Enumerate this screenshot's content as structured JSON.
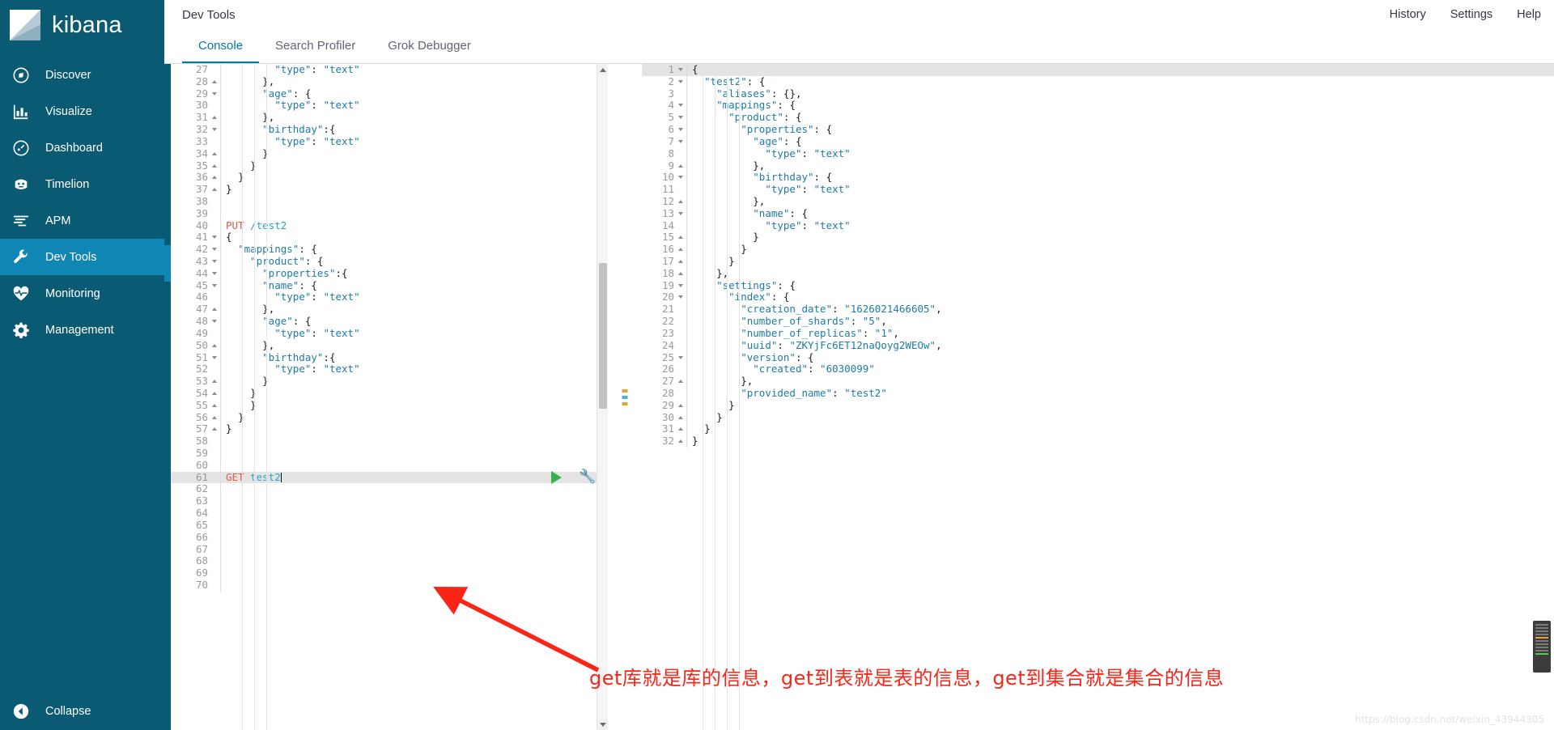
{
  "app": {
    "brand": "kibana",
    "brand_logo_icon": "kibana-logo-icon"
  },
  "sidebar": {
    "items": [
      {
        "label": "Discover",
        "icon": "compass-icon",
        "active": false
      },
      {
        "label": "Visualize",
        "icon": "bar-chart-icon",
        "active": false
      },
      {
        "label": "Dashboard",
        "icon": "dashboard-gauge-icon",
        "active": false
      },
      {
        "label": "Timelion",
        "icon": "timelion-icon",
        "active": false
      },
      {
        "label": "APM",
        "icon": "apm-lines-icon",
        "active": false
      },
      {
        "label": "Dev Tools",
        "icon": "wrench-icon",
        "active": true
      },
      {
        "label": "Monitoring",
        "icon": "heartbeat-icon",
        "active": false
      },
      {
        "label": "Management",
        "icon": "gear-icon",
        "active": false
      }
    ],
    "collapse": {
      "label": "Collapse",
      "icon": "chevron-left-circle-icon"
    }
  },
  "header": {
    "title": "Dev Tools",
    "links": [
      {
        "label": "History",
        "name": "history-link"
      },
      {
        "label": "Settings",
        "name": "settings-link"
      },
      {
        "label": "Help",
        "name": "help-link"
      }
    ]
  },
  "tabs": [
    {
      "label": "Console",
      "active": true
    },
    {
      "label": "Search Profiler",
      "active": false
    },
    {
      "label": "Grok Debugger",
      "active": false
    }
  ],
  "editor": {
    "first_line_number": 27,
    "cursor_line": 61,
    "run_button_icon": "play-triangle-icon",
    "wrench_button_icon": "wrench-icon",
    "lines": [
      {
        "n": 27,
        "fold": "",
        "text": "        \"type\": \"text\""
      },
      {
        "n": 28,
        "fold": "up",
        "text": "      },"
      },
      {
        "n": 29,
        "fold": "down",
        "text": "      \"age\": {"
      },
      {
        "n": 30,
        "fold": "",
        "text": "        \"type\": \"text\""
      },
      {
        "n": 31,
        "fold": "up",
        "text": "      },"
      },
      {
        "n": 32,
        "fold": "down",
        "text": "      \"birthday\":{"
      },
      {
        "n": 33,
        "fold": "",
        "text": "        \"type\": \"text\""
      },
      {
        "n": 34,
        "fold": "up",
        "text": "      }"
      },
      {
        "n": 35,
        "fold": "up",
        "text": "    }"
      },
      {
        "n": 36,
        "fold": "up",
        "text": "  }"
      },
      {
        "n": 37,
        "fold": "up",
        "text": "}"
      },
      {
        "n": 38,
        "fold": "",
        "text": ""
      },
      {
        "n": 39,
        "fold": "",
        "text": ""
      },
      {
        "n": 40,
        "fold": "",
        "text": "PUT /test2",
        "kind": "request"
      },
      {
        "n": 41,
        "fold": "down",
        "text": "{"
      },
      {
        "n": 42,
        "fold": "down",
        "text": "  \"mappings\": {"
      },
      {
        "n": 43,
        "fold": "down",
        "text": "    \"product\": {"
      },
      {
        "n": 44,
        "fold": "down",
        "text": "      \"properties\":{"
      },
      {
        "n": 45,
        "fold": "down",
        "text": "      \"name\": {"
      },
      {
        "n": 46,
        "fold": "",
        "text": "        \"type\": \"text\""
      },
      {
        "n": 47,
        "fold": "up",
        "text": "      },"
      },
      {
        "n": 48,
        "fold": "down",
        "text": "      \"age\": {"
      },
      {
        "n": 49,
        "fold": "",
        "text": "        \"type\": \"text\""
      },
      {
        "n": 50,
        "fold": "up",
        "text": "      },"
      },
      {
        "n": 51,
        "fold": "down",
        "text": "      \"birthday\":{"
      },
      {
        "n": 52,
        "fold": "",
        "text": "        \"type\": \"text\""
      },
      {
        "n": 53,
        "fold": "up",
        "text": "      }"
      },
      {
        "n": 54,
        "fold": "up",
        "text": "    }"
      },
      {
        "n": 55,
        "fold": "up",
        "text": "    }"
      },
      {
        "n": 56,
        "fold": "up",
        "text": "  }"
      },
      {
        "n": 57,
        "fold": "up",
        "text": "}"
      },
      {
        "n": 58,
        "fold": "",
        "text": ""
      },
      {
        "n": 59,
        "fold": "",
        "text": ""
      },
      {
        "n": 60,
        "fold": "",
        "text": ""
      },
      {
        "n": 61,
        "fold": "",
        "text": "GET test2",
        "kind": "request",
        "highlight": true
      },
      {
        "n": 62,
        "fold": "",
        "text": ""
      },
      {
        "n": 63,
        "fold": "",
        "text": ""
      },
      {
        "n": 64,
        "fold": "",
        "text": ""
      },
      {
        "n": 65,
        "fold": "",
        "text": ""
      },
      {
        "n": 66,
        "fold": "",
        "text": ""
      },
      {
        "n": 67,
        "fold": "",
        "text": ""
      },
      {
        "n": 68,
        "fold": "",
        "text": ""
      },
      {
        "n": 69,
        "fold": "",
        "text": ""
      },
      {
        "n": 70,
        "fold": "",
        "text": ""
      }
    ]
  },
  "output": {
    "lines": [
      {
        "n": 1,
        "fold": "down",
        "text": "{",
        "highlight": true
      },
      {
        "n": 2,
        "fold": "down",
        "text": "  \"test2\": {"
      },
      {
        "n": 3,
        "fold": "",
        "text": "    \"aliases\": {},"
      },
      {
        "n": 4,
        "fold": "down",
        "text": "    \"mappings\": {"
      },
      {
        "n": 5,
        "fold": "down",
        "text": "      \"product\": {"
      },
      {
        "n": 6,
        "fold": "down",
        "text": "        \"properties\": {"
      },
      {
        "n": 7,
        "fold": "down",
        "text": "          \"age\": {"
      },
      {
        "n": 8,
        "fold": "",
        "text": "            \"type\": \"text\""
      },
      {
        "n": 9,
        "fold": "up",
        "text": "          },"
      },
      {
        "n": 10,
        "fold": "down",
        "text": "          \"birthday\": {"
      },
      {
        "n": 11,
        "fold": "",
        "text": "            \"type\": \"text\""
      },
      {
        "n": 12,
        "fold": "up",
        "text": "          },"
      },
      {
        "n": 13,
        "fold": "down",
        "text": "          \"name\": {"
      },
      {
        "n": 14,
        "fold": "",
        "text": "            \"type\": \"text\""
      },
      {
        "n": 15,
        "fold": "up",
        "text": "          }"
      },
      {
        "n": 16,
        "fold": "up",
        "text": "        }"
      },
      {
        "n": 17,
        "fold": "up",
        "text": "      }"
      },
      {
        "n": 18,
        "fold": "up",
        "text": "    },"
      },
      {
        "n": 19,
        "fold": "down",
        "text": "    \"settings\": {"
      },
      {
        "n": 20,
        "fold": "down",
        "text": "      \"index\": {"
      },
      {
        "n": 21,
        "fold": "",
        "text": "        \"creation_date\": \"1626021466605\","
      },
      {
        "n": 22,
        "fold": "",
        "text": "        \"number_of_shards\": \"5\","
      },
      {
        "n": 23,
        "fold": "",
        "text": "        \"number_of_replicas\": \"1\","
      },
      {
        "n": 24,
        "fold": "",
        "text": "        \"uuid\": \"ZKYjFc6ET12naQoyg2WEOw\","
      },
      {
        "n": 25,
        "fold": "down",
        "text": "        \"version\": {"
      },
      {
        "n": 26,
        "fold": "",
        "text": "          \"created\": \"6030099\""
      },
      {
        "n": 27,
        "fold": "up",
        "text": "        },"
      },
      {
        "n": 28,
        "fold": "",
        "text": "        \"provided_name\": \"test2\""
      },
      {
        "n": 29,
        "fold": "up",
        "text": "      }"
      },
      {
        "n": 30,
        "fold": "up",
        "text": "    }"
      },
      {
        "n": 31,
        "fold": "up",
        "text": "  }"
      },
      {
        "n": 32,
        "fold": "up",
        "text": "}"
      }
    ]
  },
  "annotation": {
    "text": "get库就是库的信息，get到表就是表的信息，get到集合就是集合的信息",
    "arrow_icon": "red-arrow-icon",
    "color": "#fa2417"
  },
  "watermark": "https://blog.csdn.net/weixin_43944305",
  "colors": {
    "sidebar_bg": "#0b5a73",
    "sidebar_active": "#0f86b3",
    "accent": "#0079a5",
    "method": "#e8544d",
    "url": "#29a3c9",
    "string": "#1e7ba6",
    "run_green": "#36b14d",
    "annotation_red": "#fa2417"
  }
}
